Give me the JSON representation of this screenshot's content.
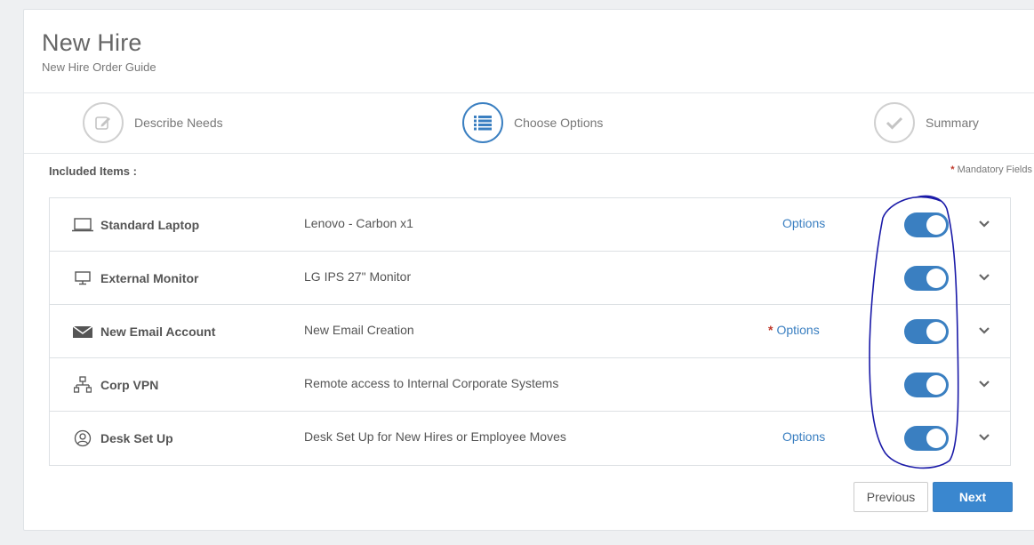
{
  "header": {
    "title": "New Hire",
    "subtitle": "New Hire Order Guide"
  },
  "steps": [
    {
      "label": "Describe Needs",
      "icon": "edit-icon",
      "active": false
    },
    {
      "label": "Choose Options",
      "icon": "list-icon",
      "active": true
    },
    {
      "label": "Summary",
      "icon": "check-icon",
      "active": false
    }
  ],
  "section": {
    "included_label": "Included Items :",
    "mandatory_star": "*",
    "mandatory_text": "Mandatory Fields"
  },
  "items": [
    {
      "name": "Standard Laptop",
      "description": "Lenovo - Carbon x1",
      "options": "Options",
      "options_star": "",
      "icon": "laptop-icon",
      "enabled": true
    },
    {
      "name": "External Monitor",
      "description": "LG IPS 27\" Monitor",
      "options": "",
      "options_star": "",
      "icon": "monitor-icon",
      "enabled": true
    },
    {
      "name": "New Email Account",
      "description": "New Email Creation",
      "options": "Options",
      "options_star": "*",
      "icon": "email-icon",
      "enabled": true
    },
    {
      "name": "Corp VPN",
      "description": "Remote access to Internal Corporate Systems",
      "options": "",
      "options_star": "",
      "icon": "network-icon",
      "enabled": true
    },
    {
      "name": "Desk Set Up",
      "description": "Desk Set Up for New Hires or Employee Moves",
      "options": "Options",
      "options_star": "",
      "icon": "user-icon",
      "enabled": true
    }
  ],
  "buttons": {
    "previous": "Previous",
    "next": "Next"
  },
  "colors": {
    "accent": "#3a7fc1",
    "annotation": "#1a1aa8",
    "required": "#c0392b"
  }
}
